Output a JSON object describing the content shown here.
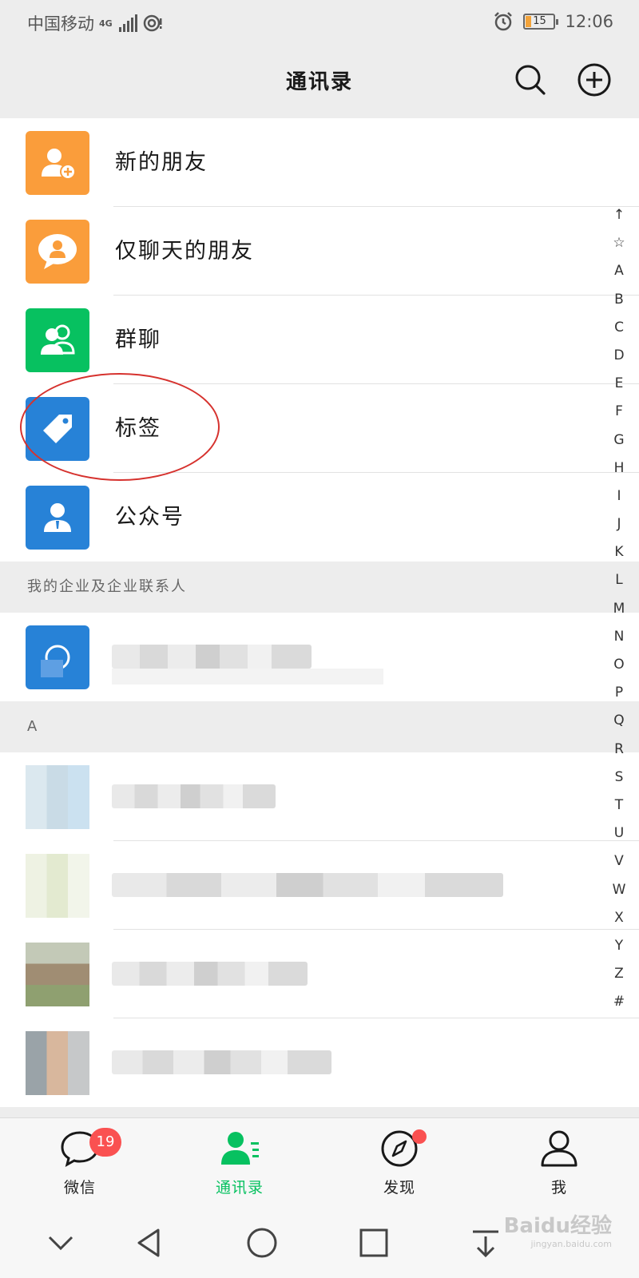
{
  "status_bar": {
    "carrier": "中国移动",
    "network": "4G",
    "time": "12:06",
    "battery": "15"
  },
  "header": {
    "title": "通讯录"
  },
  "fixed_items": [
    {
      "label": "新的朋友",
      "icon": "new-friend-icon",
      "color": "#fa9d3b"
    },
    {
      "label": "仅聊天的朋友",
      "icon": "chat-only-friend-icon",
      "color": "#fa9d3b"
    },
    {
      "label": "群聊",
      "icon": "group-chat-icon",
      "color": "#07c160"
    },
    {
      "label": "标签",
      "icon": "tag-icon",
      "color": "#2782d7"
    },
    {
      "label": "公众号",
      "icon": "official-account-icon",
      "color": "#2782d7"
    }
  ],
  "sections": {
    "enterprise": "我的企业及企业联系人",
    "a": "A"
  },
  "index": [
    "↑",
    "☆",
    "A",
    "B",
    "C",
    "D",
    "E",
    "F",
    "G",
    "H",
    "I",
    "J",
    "K",
    "L",
    "M",
    "N",
    "O",
    "P",
    "Q",
    "R",
    "S",
    "T",
    "U",
    "V",
    "W",
    "X",
    "Y",
    "Z",
    "#"
  ],
  "tabs": [
    {
      "label": "微信",
      "icon": "chat-bubble-icon",
      "badge": "19"
    },
    {
      "label": "通讯录",
      "icon": "contacts-icon",
      "active": true
    },
    {
      "label": "发现",
      "icon": "compass-icon",
      "dot": true
    },
    {
      "label": "我",
      "icon": "person-icon"
    }
  ],
  "watermark": {
    "text": "Baidu经验",
    "sub": "jingyan.baidu.com"
  },
  "colors": {
    "accent": "#07c160",
    "badge": "#fa5151",
    "annotation": "#d6322e"
  }
}
